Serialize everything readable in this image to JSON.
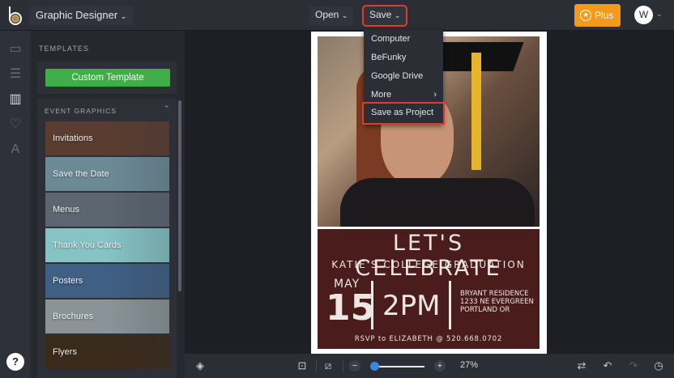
{
  "topbar": {
    "app_name": "Graphic Designer",
    "open_label": "Open",
    "save_label": "Save",
    "plus_label": "Plus",
    "avatar_initial": "W"
  },
  "save_menu": {
    "items": [
      "Computer",
      "BeFunky",
      "Google Drive",
      "More",
      "Save as Project"
    ]
  },
  "panel": {
    "heading": "TEMPLATES",
    "custom_template_label": "Custom Template",
    "section_label": "EVENT GRAPHICS",
    "cards": [
      {
        "label": "Invitations",
        "color": "#5a3d30"
      },
      {
        "label": "Save the Date",
        "color": "#6c8a96"
      },
      {
        "label": "Menus",
        "color": "#5b6670"
      },
      {
        "label": "Thank You Cards",
        "color": "#86c3c4"
      },
      {
        "label": "Posters",
        "color": "#3f5f84"
      },
      {
        "label": "Brochures",
        "color": "#8a9498"
      },
      {
        "label": "Flyers",
        "color": "#3a2a1a"
      }
    ]
  },
  "poster": {
    "title": "LET'S CELEBRATE",
    "subtitle": "KATIE'S COLLEGE GRADUATION",
    "month": "MAY",
    "day": "15",
    "time": "2PM",
    "address": [
      "BRYANT RESIDENCE",
      "1233 NE EVERGREEN",
      "PORTLAND OR"
    ],
    "rsvp": "RSVP to ELIZABETH @ 520.668.0702"
  },
  "bottombar": {
    "zoom_percent": "27%",
    "zoom_value": 27
  },
  "help_label": "?"
}
